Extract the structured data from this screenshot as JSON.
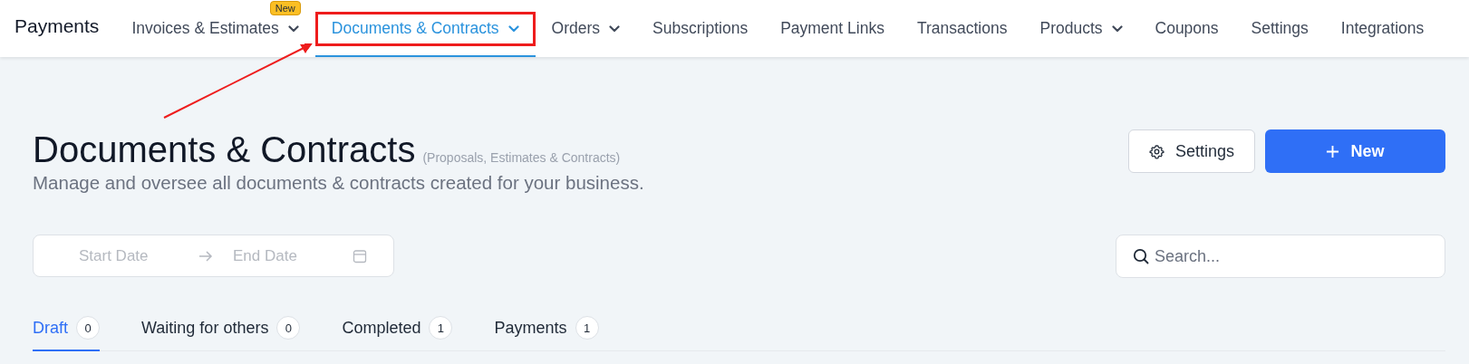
{
  "app_title": "Payments",
  "nav": [
    {
      "label": "Invoices & Estimates",
      "dropdown": true,
      "badge": "New",
      "selected": false,
      "highlighted": false
    },
    {
      "label": "Documents & Contracts",
      "dropdown": true,
      "selected": true,
      "highlighted": true
    },
    {
      "label": "Orders",
      "dropdown": true,
      "selected": false,
      "highlighted": false
    },
    {
      "label": "Subscriptions",
      "dropdown": false,
      "selected": false,
      "highlighted": false
    },
    {
      "label": "Payment Links",
      "dropdown": false,
      "selected": false,
      "highlighted": false
    },
    {
      "label": "Transactions",
      "dropdown": false,
      "selected": false,
      "highlighted": false
    },
    {
      "label": "Products",
      "dropdown": true,
      "selected": false,
      "highlighted": false
    },
    {
      "label": "Coupons",
      "dropdown": false,
      "selected": false,
      "highlighted": false
    },
    {
      "label": "Settings",
      "dropdown": false,
      "selected": false,
      "highlighted": false
    },
    {
      "label": "Integrations",
      "dropdown": false,
      "selected": false,
      "highlighted": false
    }
  ],
  "page": {
    "title": "Documents & Contracts",
    "title_note": "(Proposals, Estimates & Contracts)",
    "subtitle": "Manage and oversee all documents & contracts created for your business."
  },
  "buttons": [
    {
      "kind": "secondary",
      "label": "Settings"
    },
    {
      "kind": "primary",
      "label": "New"
    }
  ],
  "date_range": {
    "start_placeholder": "Start Date",
    "end_placeholder": "End Date"
  },
  "search": {
    "placeholder": "Search..."
  },
  "tabs": [
    {
      "label": "Draft",
      "count": "0",
      "selected": true
    },
    {
      "label": "Waiting for others",
      "count": "0",
      "selected": false
    },
    {
      "label": "Completed",
      "count": "1",
      "selected": false
    },
    {
      "label": "Payments",
      "count": "1",
      "selected": false
    }
  ],
  "annotation": {
    "kind": "arrow"
  }
}
